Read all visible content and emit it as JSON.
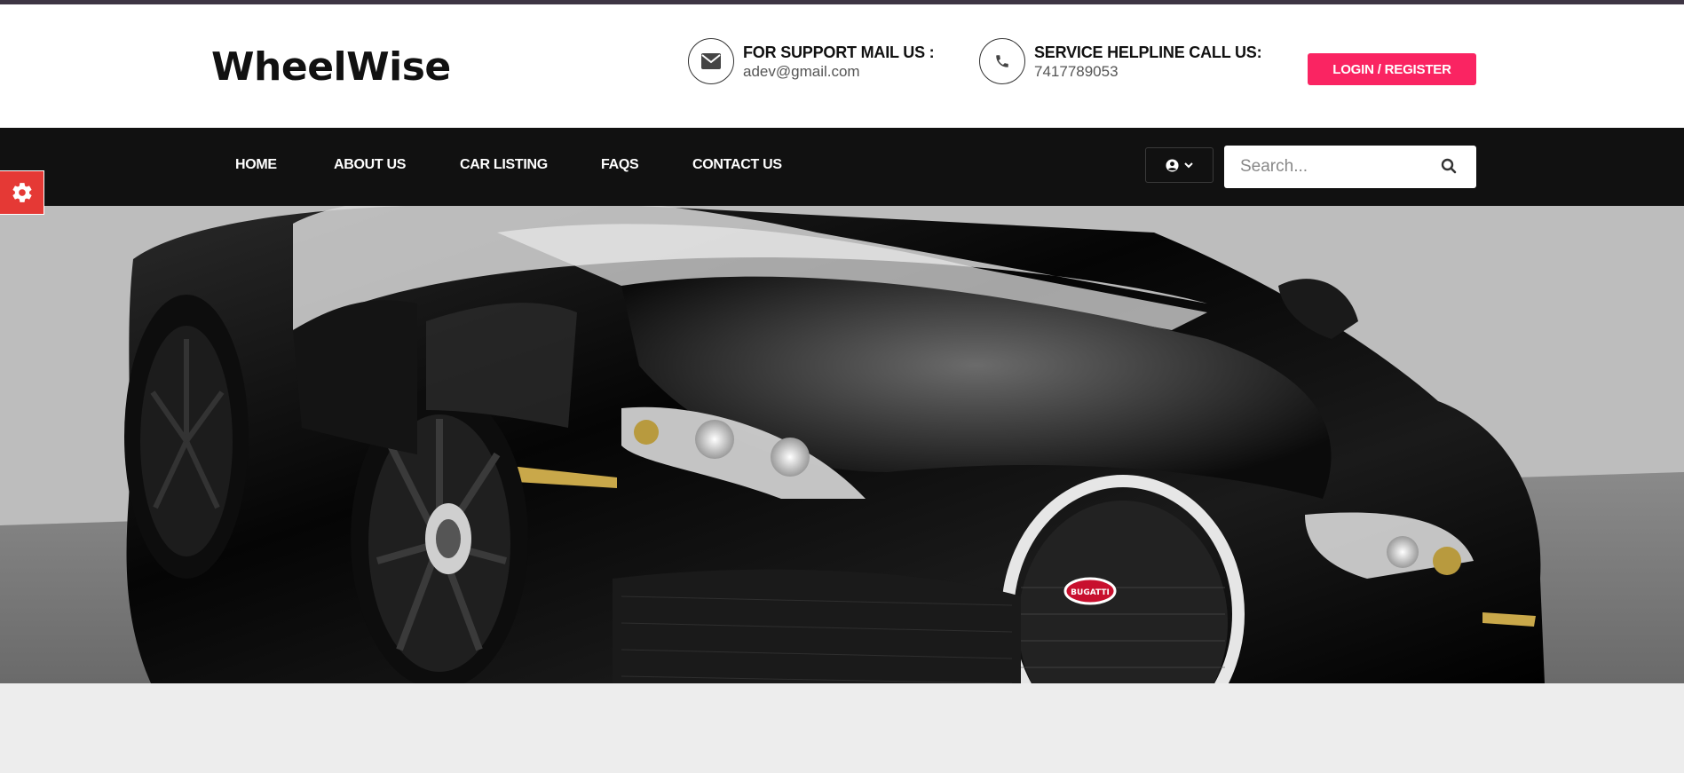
{
  "brand": {
    "name": "WheelWise"
  },
  "header": {
    "support": {
      "label": "FOR SUPPORT MAIL US :",
      "value": "adev@gmail.com",
      "icon": "envelope-icon"
    },
    "helpline": {
      "label": "SERVICE HELPLINE CALL US:",
      "value": "7417789053",
      "icon": "phone-icon"
    },
    "login_label": "LOGIN / REGISTER"
  },
  "nav": {
    "items": [
      {
        "label": "HOME"
      },
      {
        "label": "ABOUT US"
      },
      {
        "label": "CAR LISTING"
      },
      {
        "label": "FAQS"
      },
      {
        "label": "CONTACT US"
      }
    ],
    "user_menu_icon": "user-circle-icon",
    "search": {
      "placeholder": "Search...",
      "value": "",
      "icon": "search-icon"
    }
  },
  "settings_tab": {
    "icon": "gear-icon"
  },
  "hero": {
    "image": "black sports car banner",
    "emblem_text": "BUGATTI"
  },
  "colors": {
    "accent": "#fa2462",
    "navbar": "#111111",
    "top_strip": "#3e3544",
    "settings_tab": "#e53935",
    "page_bg": "#ededed"
  }
}
